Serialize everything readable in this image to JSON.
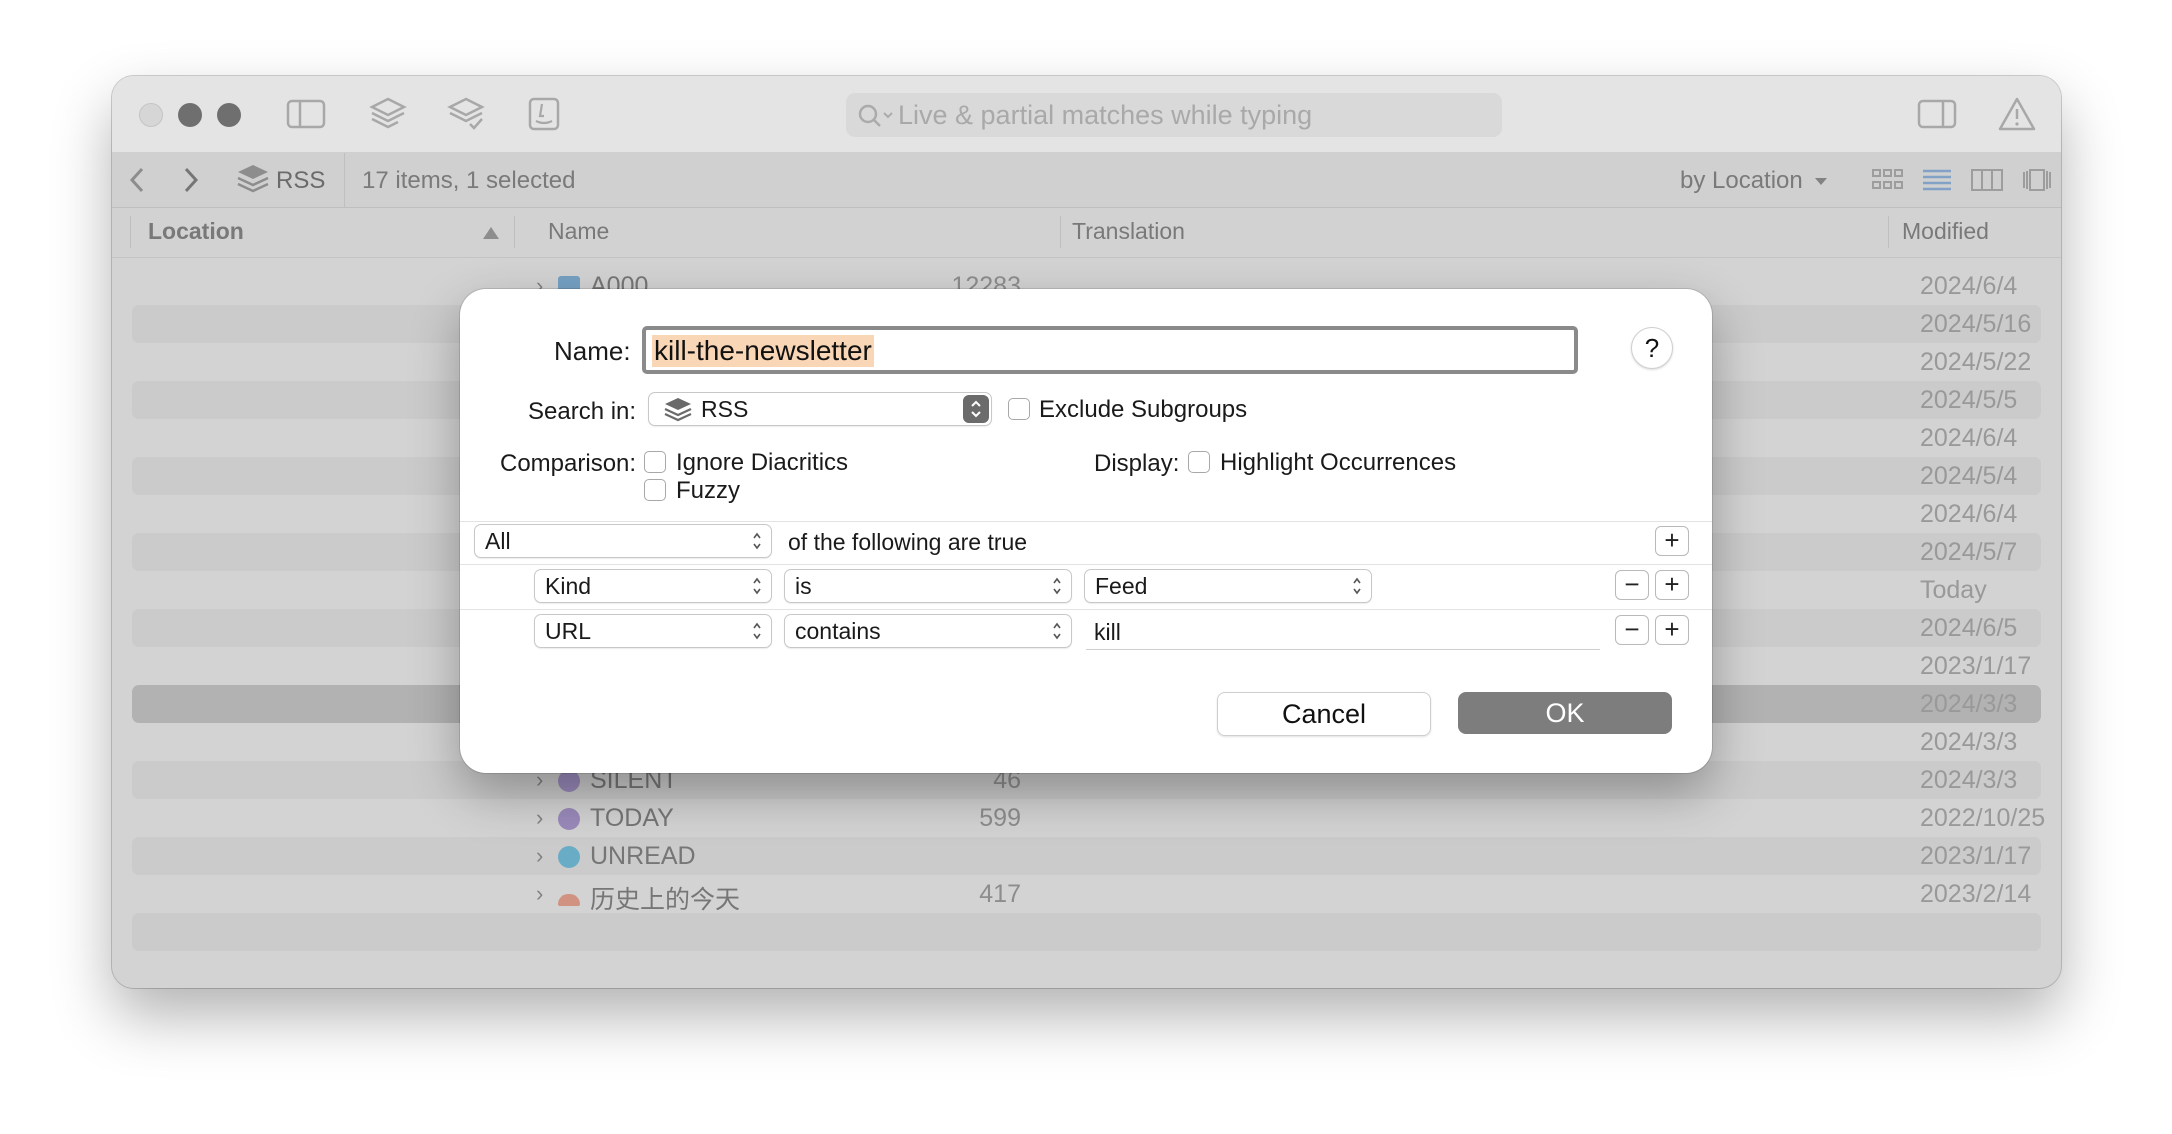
{
  "window": {
    "search_placeholder": "Live & partial matches while typing",
    "path_label": "RSS",
    "status_text": "17 items, 1 selected",
    "sort_label": "by Location"
  },
  "columns": {
    "location": "Location",
    "name": "Name",
    "translation": "Translation",
    "modified": "Modified"
  },
  "rows": [
    {
      "name": "A000",
      "count": "12283",
      "date": "2024/6/4",
      "icon_color": "#6aa6d4"
    },
    {
      "name": "",
      "count": "",
      "date": "2024/5/16"
    },
    {
      "name": "",
      "count": "",
      "date": "2024/5/22"
    },
    {
      "name": "",
      "count": "",
      "date": "2024/5/5"
    },
    {
      "name": "",
      "count": "",
      "date": "2024/6/4"
    },
    {
      "name": "",
      "count": "",
      "date": "2024/5/4"
    },
    {
      "name": "",
      "count": "",
      "date": "2024/6/4"
    },
    {
      "name": "",
      "count": "",
      "date": "2024/5/7"
    },
    {
      "name": "",
      "count": "",
      "date": "Today"
    },
    {
      "name": "",
      "count": "",
      "date": "2024/6/5"
    },
    {
      "name": "",
      "count": "",
      "date": "2023/1/17"
    },
    {
      "name": "",
      "count": "",
      "date": "2024/3/3"
    },
    {
      "name": "",
      "count": "",
      "date": "2024/3/3"
    },
    {
      "name": "SILENT",
      "count": "46",
      "date": "2024/3/3",
      "icon_color": "#9b86c9"
    },
    {
      "name": "TODAY",
      "count": "599",
      "date": "2022/10/25",
      "icon_color": "#9b86c9"
    },
    {
      "name": "UNREAD",
      "count": "",
      "date": "2023/1/17",
      "icon_color": "#58b4d8"
    },
    {
      "name": "历史上的今天",
      "count": "417",
      "date": "2023/2/14",
      "icon_color": "#e8907a"
    }
  ],
  "dialog": {
    "name_label": "Name:",
    "name_value": "kill-the-newsletter",
    "help_label": "?",
    "search_in_label": "Search in:",
    "search_in_value": "RSS",
    "exclude_subgroups": "Exclude Subgroups",
    "comparison_label": "Comparison:",
    "ignore_diacritics": "Ignore Diacritics",
    "fuzzy": "Fuzzy",
    "display_label": "Display:",
    "highlight_occurrences": "Highlight Occurrences",
    "match_mode": "All",
    "match_suffix": "of the following are true",
    "rules": [
      {
        "field": "Kind",
        "operator": "is",
        "value": "Feed"
      },
      {
        "field": "URL",
        "operator": "contains",
        "value": "kill"
      }
    ],
    "plus": "+",
    "minus": "−",
    "cancel": "Cancel",
    "ok": "OK"
  }
}
